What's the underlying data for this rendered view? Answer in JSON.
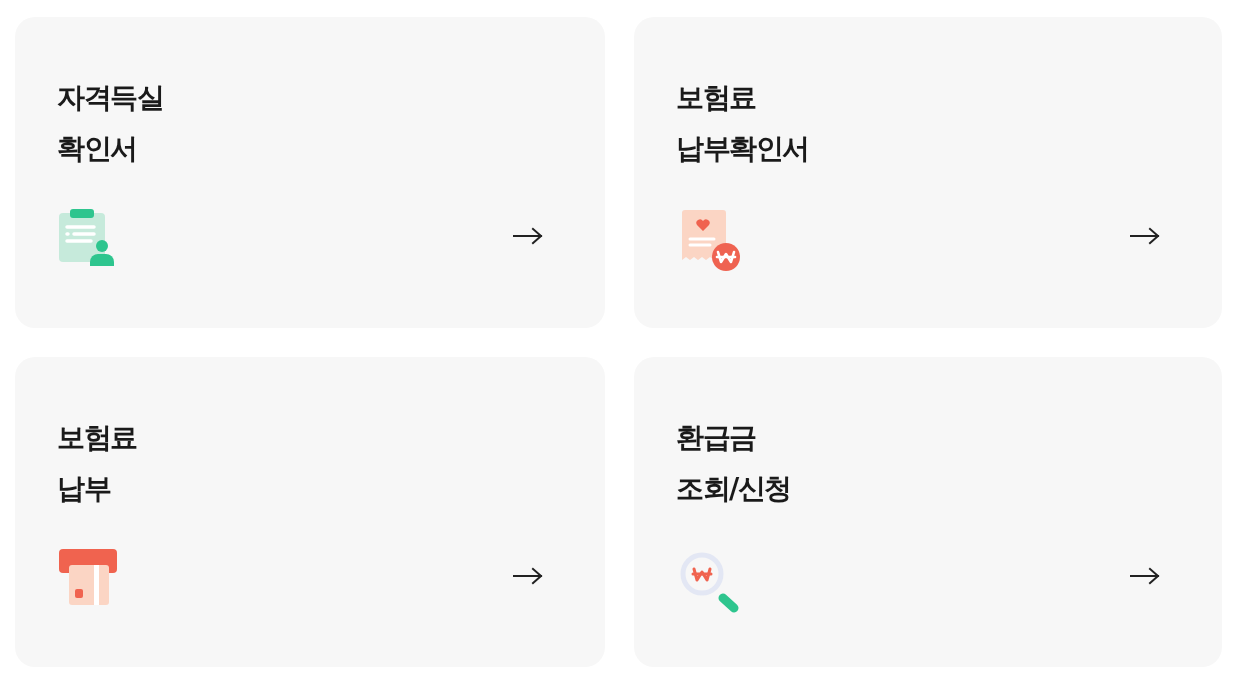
{
  "cards": [
    {
      "title_lines": [
        "자격득실",
        "확인서"
      ]
    },
    {
      "title_lines": [
        "보험료",
        "납부확인서"
      ]
    },
    {
      "title_lines": [
        "보험료",
        "납부"
      ]
    },
    {
      "title_lines": [
        "환급금",
        "조회/신청"
      ]
    }
  ]
}
